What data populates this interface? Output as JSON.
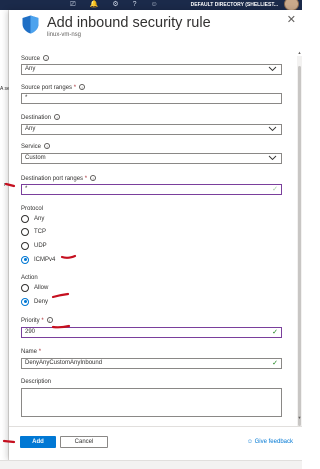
{
  "topbar": {
    "icons": [
      "screen-icon",
      "bell-icon",
      "gear-icon",
      "help-icon",
      "feedback-icon"
    ],
    "directory": "DEFAULT DIRECTORY (SHELLIEST..."
  },
  "left_fragments": [
    "A se",
    "r"
  ],
  "panel": {
    "title": "Add inbound security rule",
    "subtitle": "linux-vm-nsg",
    "close_glyph": "✕"
  },
  "form": {
    "source": {
      "label": "Source",
      "value": "Any"
    },
    "source_port_ranges": {
      "label": "Source port ranges",
      "required": "*",
      "value": "*"
    },
    "destination": {
      "label": "Destination",
      "value": "Any"
    },
    "service": {
      "label": "Service",
      "value": "Custom"
    },
    "destination_port_ranges": {
      "label": "Destination port ranges",
      "required": "*",
      "value": "*"
    },
    "protocol": {
      "label": "Protocol",
      "options": [
        "Any",
        "TCP",
        "UDP",
        "ICMPv4"
      ],
      "selected": "ICMPv4"
    },
    "action": {
      "label": "Action",
      "options": [
        "Allow",
        "Deny"
      ],
      "selected": "Deny"
    },
    "priority": {
      "label": "Priority",
      "required": "*",
      "value": "290"
    },
    "name": {
      "label": "Name",
      "required": "*",
      "value": "DenyAnyCustomAnyInbound"
    },
    "description": {
      "label": "Description",
      "value": ""
    }
  },
  "footer": {
    "add_label": "Add",
    "cancel_label": "Cancel",
    "feedback_label": "Give feedback"
  },
  "colors": {
    "accent": "#0078d4",
    "annotation": "#c50f1f",
    "valid_check": "#107c10",
    "focus_border": "#7a3f9c"
  }
}
